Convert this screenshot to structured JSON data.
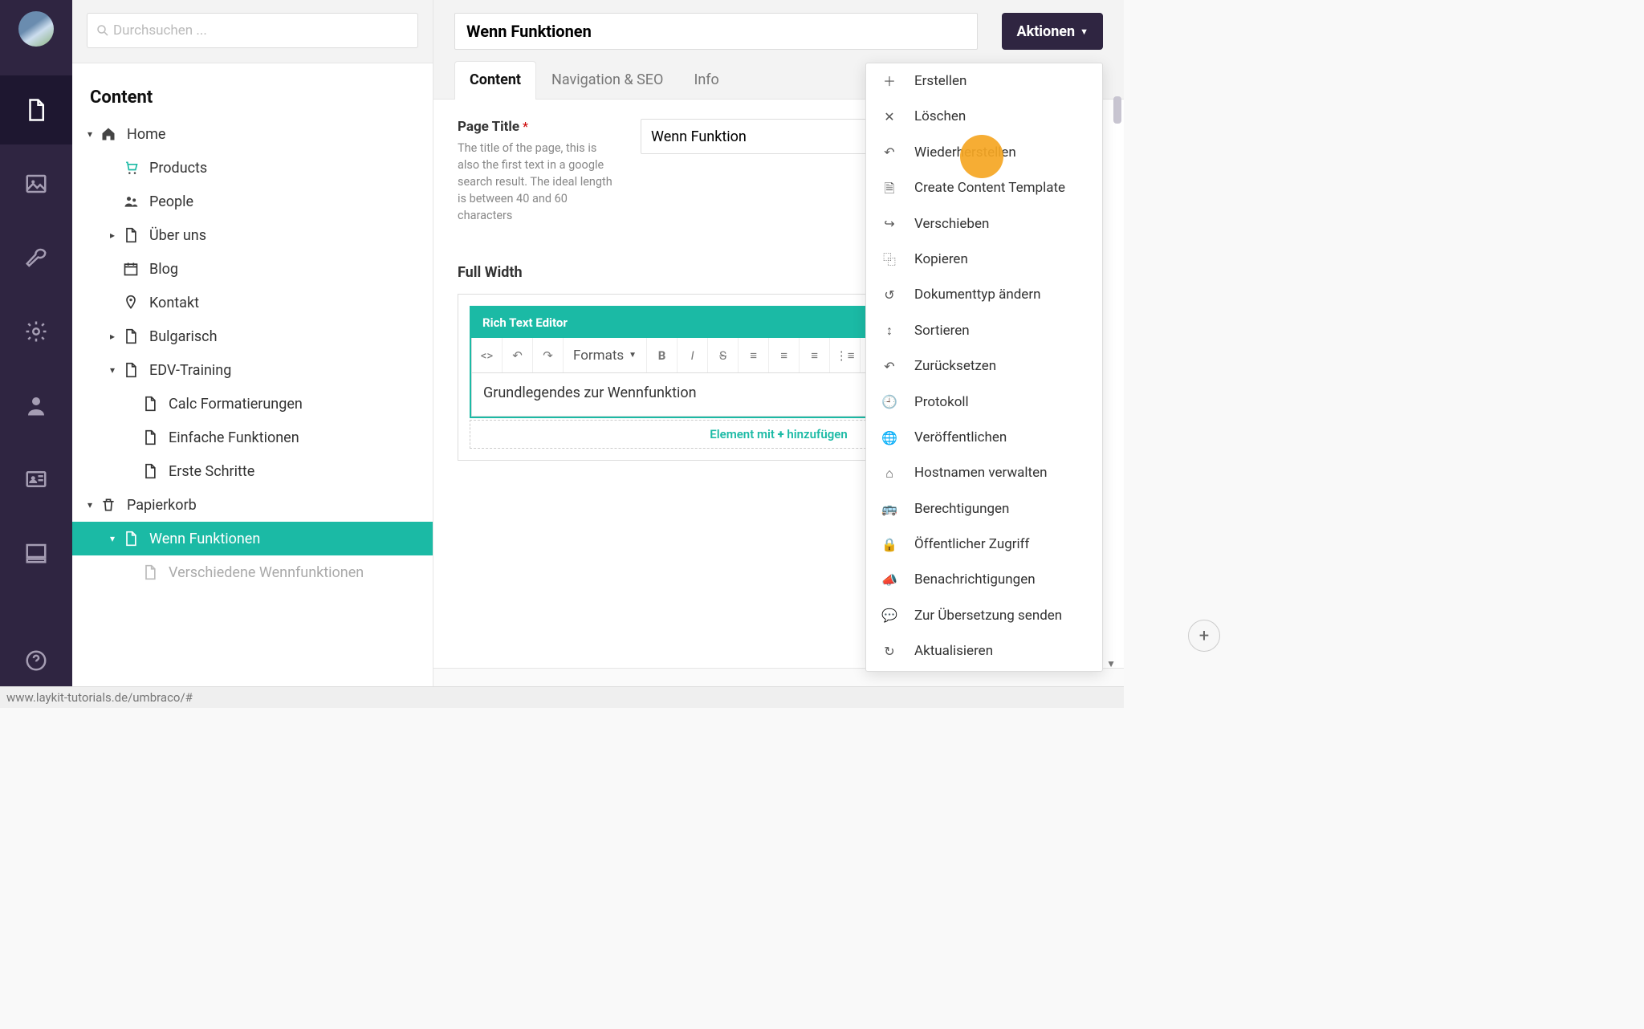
{
  "search": {
    "placeholder": "Durchsuchen ..."
  },
  "section_title": "Content",
  "tree": {
    "home": "Home",
    "products": "Products",
    "people": "People",
    "about": "Über uns",
    "blog": "Blog",
    "contact": "Kontakt",
    "bulgarian": "Bulgarisch",
    "edv": "EDV-Training",
    "calc": "Calc Formatierungen",
    "simplefn": "Einfache Funktionen",
    "firststeps": "Erste Schritte",
    "trash": "Papierkorb",
    "wennfn": "Wenn Funktionen",
    "variouswenn": "Verschiedene Wennfunktionen"
  },
  "header": {
    "title_value": "Wenn Funktionen",
    "actions_label": "Aktionen"
  },
  "tabs": {
    "content": "Content",
    "nav": "Navigation & SEO",
    "info": "Info"
  },
  "fields": {
    "page_title_label": "Page Title",
    "page_title_desc": "The title of the page, this is also the first text in a google search result. The ideal length is between 40 and 60 characters",
    "page_title_value": "Wenn Funktion",
    "full_width_label": "Full Width"
  },
  "rte": {
    "header": "Rich Text Editor",
    "formats_label": "Formats",
    "body_text": "Grundlegendes zur Wennfunktion",
    "add_prefix": "Element mit",
    "add_suffix": "hinzufügen"
  },
  "breadcrumb": "Wenn Funktionen",
  "statusbar_url": "www.laykit-tutorials.de/umbraco/#",
  "actions_menu": [
    {
      "icon": "＋",
      "label": "Erstellen"
    },
    {
      "icon": "✕",
      "label": "Löschen"
    },
    {
      "icon": "↶",
      "label": "Wiederherstellen"
    },
    {
      "icon": "🗎",
      "label": "Create Content Template"
    },
    {
      "icon": "↪",
      "label": "Verschieben"
    },
    {
      "icon": "⿻",
      "label": "Kopieren"
    },
    {
      "icon": "↺",
      "label": "Dokumenttyp ändern"
    },
    {
      "icon": "↕",
      "label": "Sortieren"
    },
    {
      "icon": "↶",
      "label": "Zurücksetzen"
    },
    {
      "icon": "🕘",
      "label": "Protokoll"
    },
    {
      "icon": "🌐",
      "label": "Veröffentlichen"
    },
    {
      "icon": "⌂",
      "label": "Hostnamen verwalten"
    },
    {
      "icon": "🚌",
      "label": "Berechtigungen"
    },
    {
      "icon": "🔒",
      "label": "Öffentlicher Zugriff"
    },
    {
      "icon": "📣",
      "label": "Benachrichtigungen"
    },
    {
      "icon": "💬",
      "label": "Zur Übersetzung senden"
    },
    {
      "icon": "↻",
      "label": "Aktualisieren"
    }
  ]
}
